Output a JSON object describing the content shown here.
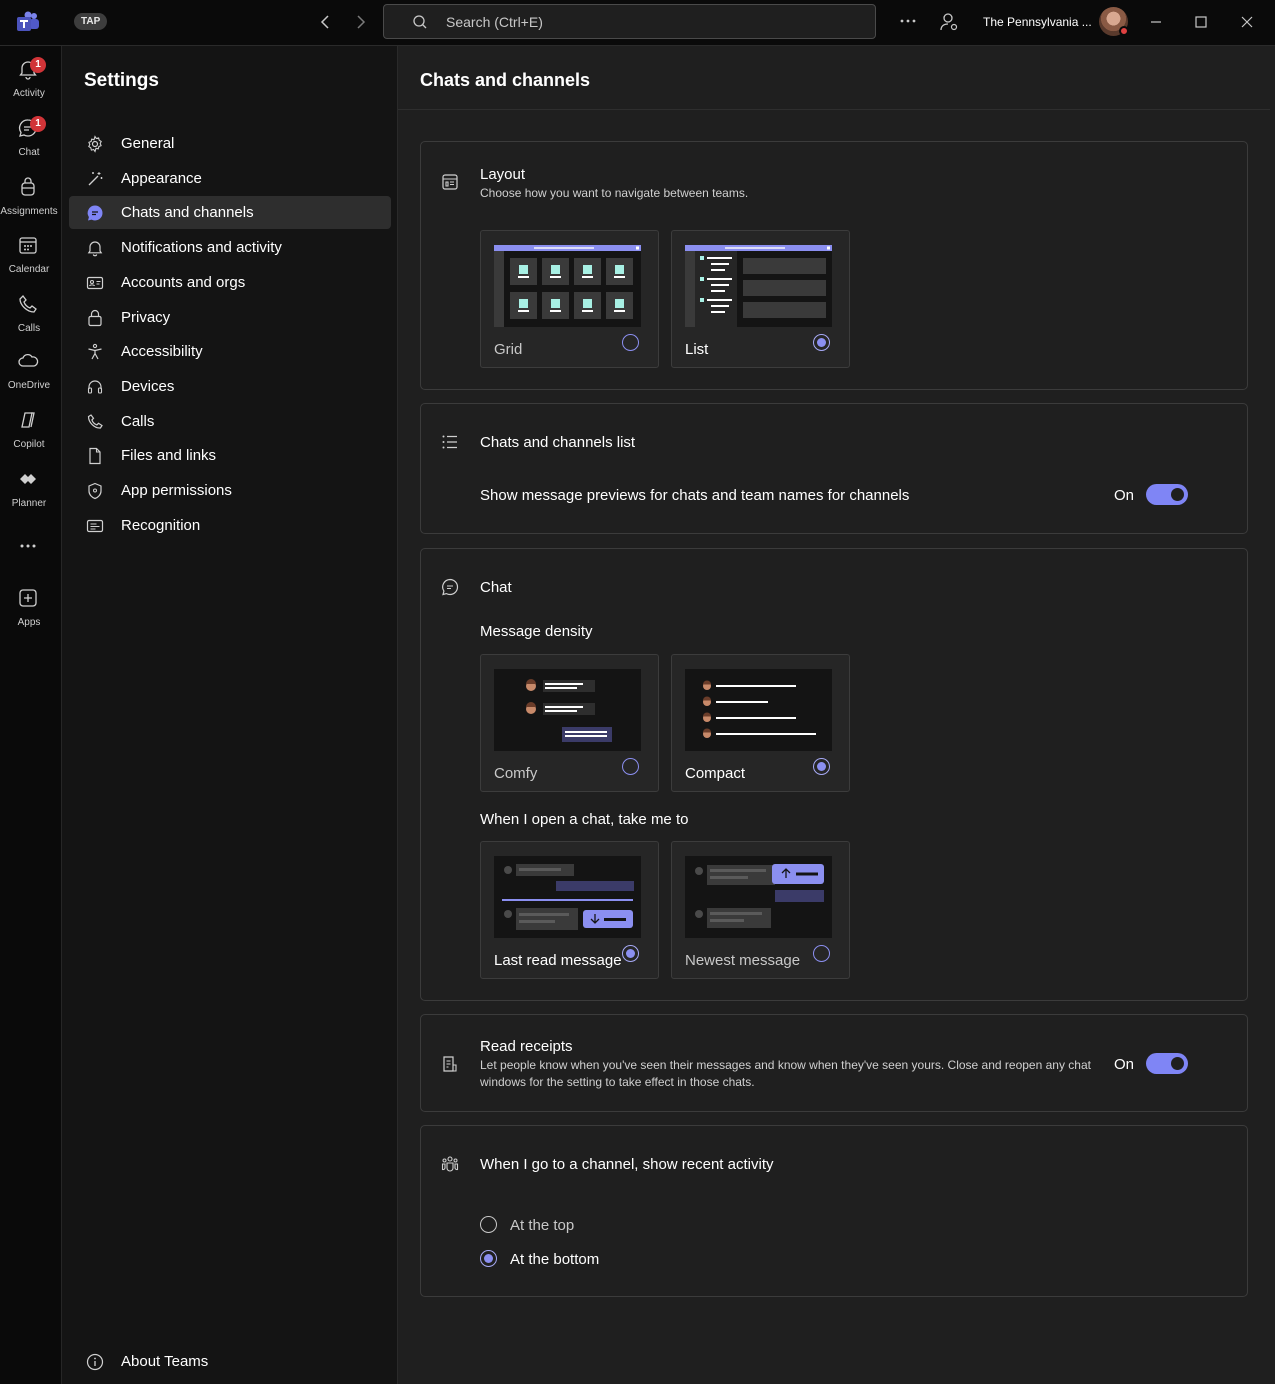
{
  "app": {
    "badge": "TAP",
    "search_placeholder": "Search (Ctrl+E)",
    "org_name": "The Pennsylvania ...",
    "accent": "#7f85f5"
  },
  "rail": {
    "items": [
      {
        "label": "Activity",
        "icon": "bell-icon",
        "badge": "1"
      },
      {
        "label": "Chat",
        "icon": "chat-icon",
        "badge": "1"
      },
      {
        "label": "Assignments",
        "icon": "backpack-icon"
      },
      {
        "label": "Calendar",
        "icon": "calendar-icon"
      },
      {
        "label": "Calls",
        "icon": "phone-icon"
      },
      {
        "label": "OneDrive",
        "icon": "cloud-icon"
      },
      {
        "label": "Copilot",
        "icon": "copilot-icon"
      },
      {
        "label": "Planner",
        "icon": "planner-icon"
      },
      {
        "label": "Apps",
        "icon": "add-app-icon"
      }
    ]
  },
  "settings_nav": {
    "title": "Settings",
    "items": [
      {
        "label": "General",
        "icon": "gear-icon"
      },
      {
        "label": "Appearance",
        "icon": "magic-wand-icon"
      },
      {
        "label": "Chats and channels",
        "icon": "chat-bubble-icon",
        "active": true
      },
      {
        "label": "Notifications and activity",
        "icon": "bell-icon"
      },
      {
        "label": "Accounts and orgs",
        "icon": "id-card-icon"
      },
      {
        "label": "Privacy",
        "icon": "lock-icon"
      },
      {
        "label": "Accessibility",
        "icon": "accessibility-icon"
      },
      {
        "label": "Devices",
        "icon": "headset-icon"
      },
      {
        "label": "Calls",
        "icon": "phone-icon"
      },
      {
        "label": "Files and links",
        "icon": "document-icon"
      },
      {
        "label": "App permissions",
        "icon": "shield-icon"
      },
      {
        "label": "Recognition",
        "icon": "recognition-icon"
      }
    ],
    "footer_label": "About Teams"
  },
  "main": {
    "title": "Chats and channels",
    "layout": {
      "title": "Layout",
      "description": "Choose how you want to navigate between teams.",
      "options": [
        {
          "label": "Grid",
          "selected": false
        },
        {
          "label": "List",
          "selected": true
        }
      ]
    },
    "list": {
      "title": "Chats and channels list",
      "setting": "Show message previews for chats and team names for channels",
      "state": "On"
    },
    "chat": {
      "title": "Chat",
      "density_label": "Message density",
      "density_options": [
        {
          "label": "Comfy",
          "selected": false
        },
        {
          "label": "Compact",
          "selected": true
        }
      ],
      "open_label": "When I open a chat, take me to",
      "open_options": [
        {
          "label": "Last read message",
          "selected": true
        },
        {
          "label": "Newest message",
          "selected": false
        }
      ]
    },
    "receipts": {
      "title": "Read receipts",
      "description": "Let people know when you've seen their messages and know when they've seen yours. Close and reopen any chat windows for the setting to take effect in those chats.",
      "state": "On"
    },
    "channel": {
      "title": "When I go to a channel, show recent activity",
      "options": [
        {
          "label": "At the top",
          "selected": false
        },
        {
          "label": "At the bottom",
          "selected": true
        }
      ]
    }
  }
}
